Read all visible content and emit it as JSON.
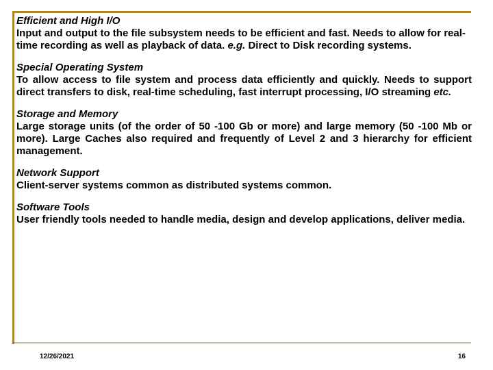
{
  "sections": [
    {
      "heading": "Efficient and High I/O",
      "body_pre": "Input and output to the file subsystem needs to be efficient and fast. Needs to allow for real-time recording as well as playback of data. ",
      "eg": "e.g.",
      "body_post": " Direct to Disk recording systems.",
      "justify": false
    },
    {
      "heading": "Special Operating System",
      "body_pre": "To allow access to file system and process data efficiently and quickly. Needs to support direct transfers to disk, real-time scheduling, fast interrupt processing, I/O streaming ",
      "etc": "etc.",
      "body_post": "",
      "justify": true
    },
    {
      "heading": "Storage and Memory",
      "body_pre": "Large storage units (of the order of 50 -100 Gb or more) and large memory (50 -100 Mb or more). Large Caches also required and frequently of Level 2 and 3 hierarchy for efficient management.",
      "body_post": "",
      "justify": true
    },
    {
      "heading": "Network Support",
      "body_pre": "Client-server systems common as distributed systems common.",
      "body_post": "",
      "justify": false
    },
    {
      "heading": "Software Tools",
      "body_pre": "User friendly tools needed to handle media, design and develop applications, deliver media.",
      "body_post": "",
      "justify": false
    }
  ],
  "footer": {
    "date": "12/26/2021",
    "page": "16"
  }
}
